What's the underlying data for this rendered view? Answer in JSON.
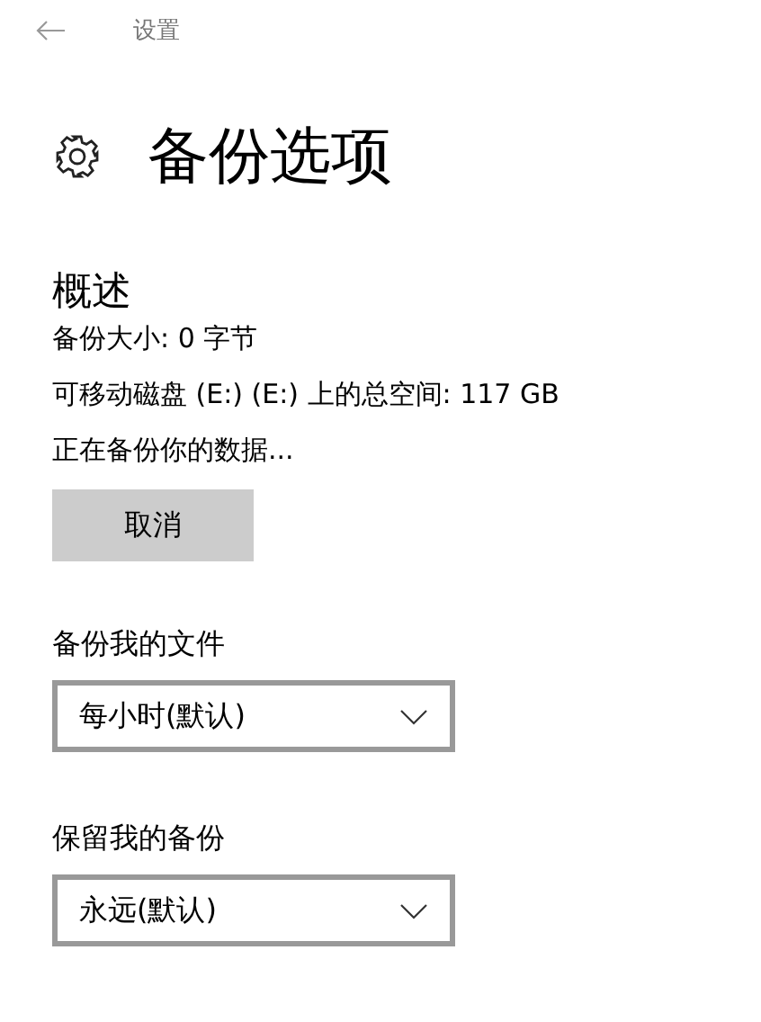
{
  "header": {
    "title": "设置"
  },
  "page": {
    "title": "备份选项"
  },
  "overview": {
    "heading": "概述",
    "lines": [
      "备份大小: 0 字节",
      "可移动磁盘 (E:) (E:) 上的总空间: 117 GB",
      "正在备份你的数据..."
    ],
    "button": "取消"
  },
  "settings": [
    {
      "label": "备份我的文件",
      "value": "每小时(默认)"
    },
    {
      "label": "保留我的备份",
      "value": "永远(默认)"
    }
  ]
}
